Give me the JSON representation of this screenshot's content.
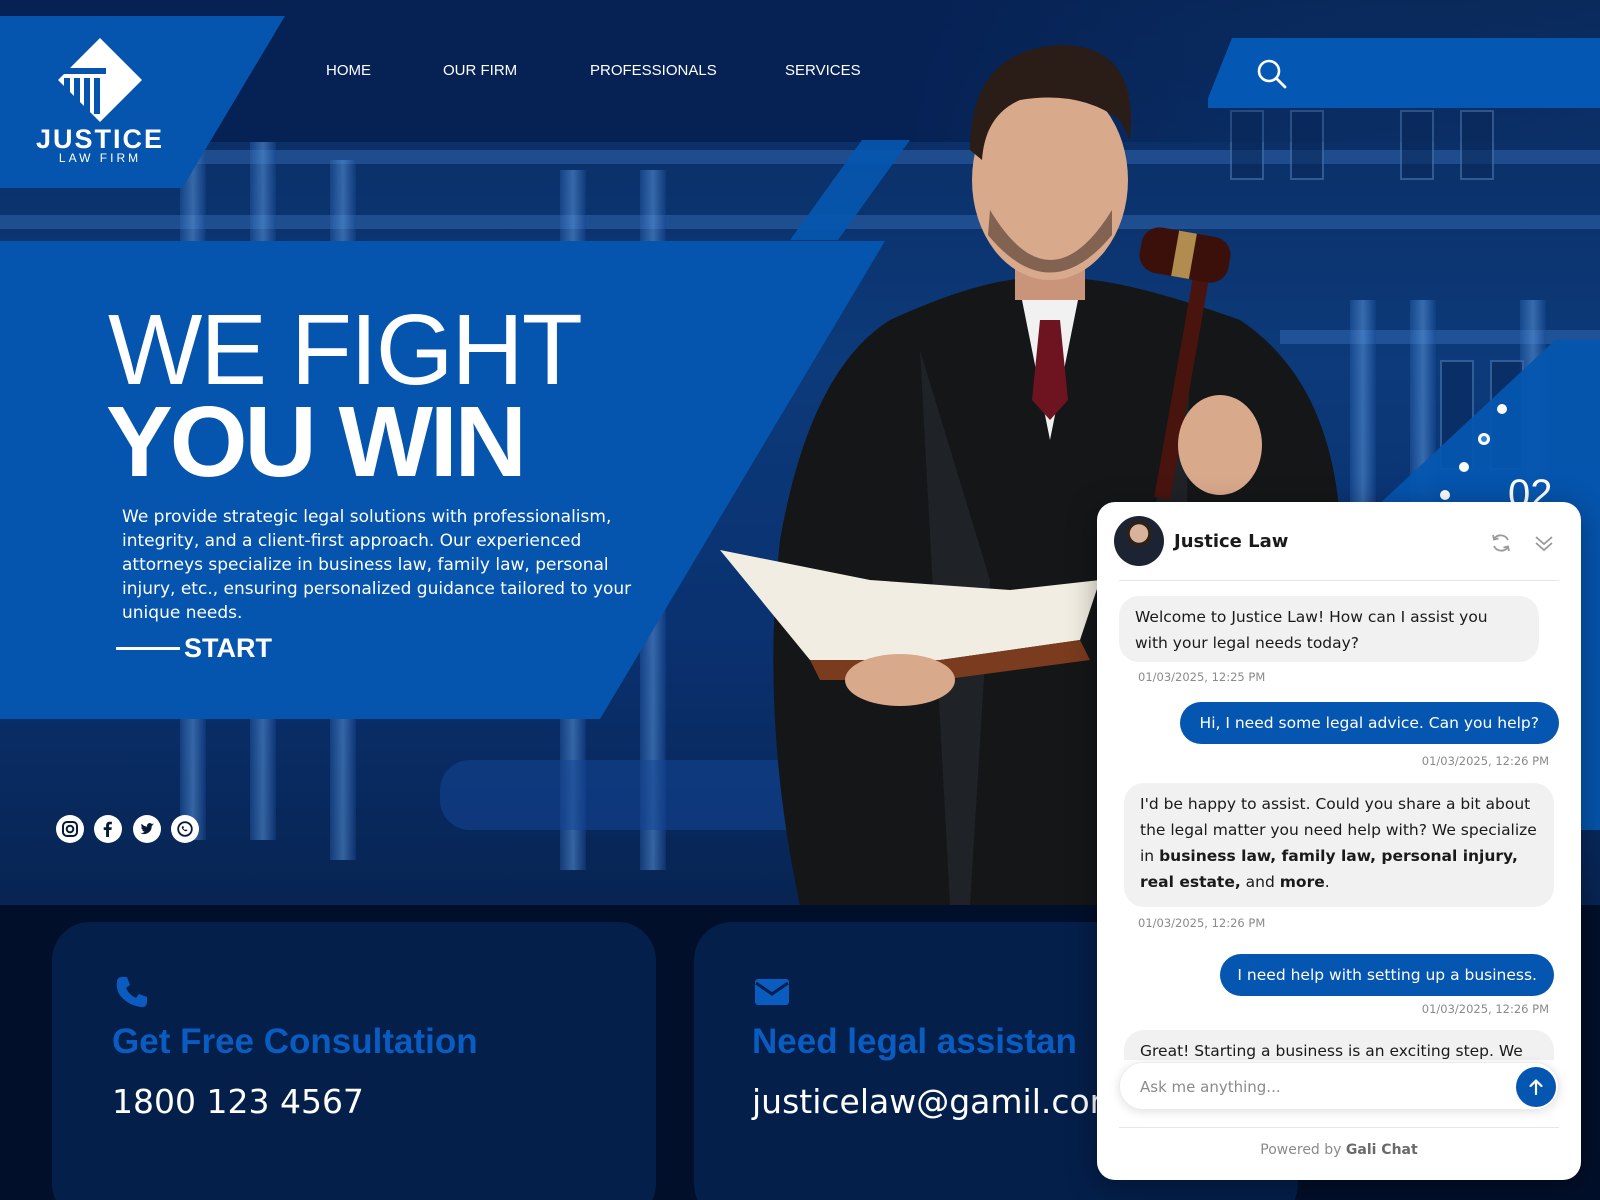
{
  "brand": {
    "name": "JUSTICE",
    "tagline": "LAW FIRM"
  },
  "nav": {
    "items": [
      "HOME",
      "OUR FIRM",
      "PROFESSIONALS",
      "SERVICES"
    ]
  },
  "hero": {
    "headline_line1": "WE FIGHT",
    "headline_line2": "YOU WIN",
    "description": "We provide strategic legal solutions with professionalism, integrity, and a client-first approach. Our experienced attorneys specialize in business law, family law, personal injury, etc., ensuring personalized guidance tailored to your unique needs.",
    "cta": "START",
    "slide_number": "02"
  },
  "social": [
    "instagram-icon",
    "facebook-icon",
    "twitter-icon",
    "whatsapp-icon"
  ],
  "cards": [
    {
      "icon": "phone-icon",
      "title": "Get Free Consultation",
      "value": "1800 123 4567"
    },
    {
      "icon": "mail-icon",
      "title": "Need legal assistan",
      "value": "justicelaw@gamil.com"
    }
  ],
  "chat": {
    "name": "Justice Law",
    "messages": [
      {
        "from": "bot",
        "text": "Welcome to Justice Law! How can I assist you with your legal needs today?",
        "time": "01/03/2025, 12:25 PM"
      },
      {
        "from": "user",
        "text": "Hi, I need some legal advice. Can you help?",
        "time": "01/03/2025, 12:26 PM"
      },
      {
        "from": "bot",
        "text_prefix": "I'd be happy to assist. Could you share a bit about the legal matter you need help with? We specialize in ",
        "text_bold": "business law, family law, personal injury, real estate,",
        "text_mid": " and ",
        "text_bold2": "more",
        "text_suffix": ".",
        "time": "01/03/2025, 12:26 PM"
      },
      {
        "from": "user",
        "text": "I need help with setting up a business.",
        "time": "01/03/2025, 12:26 PM"
      },
      {
        "from": "bot",
        "text": "Great! Starting a business is an exciting step. We"
      }
    ],
    "input_placeholder": "Ask me anything...",
    "powered_by_prefix": "Powered by ",
    "powered_by_brand": "Gali Chat"
  },
  "colors": {
    "primary": "#0555ae",
    "dark": "#062154",
    "card": "#041f4a",
    "accent_text": "#0a5cc0"
  }
}
